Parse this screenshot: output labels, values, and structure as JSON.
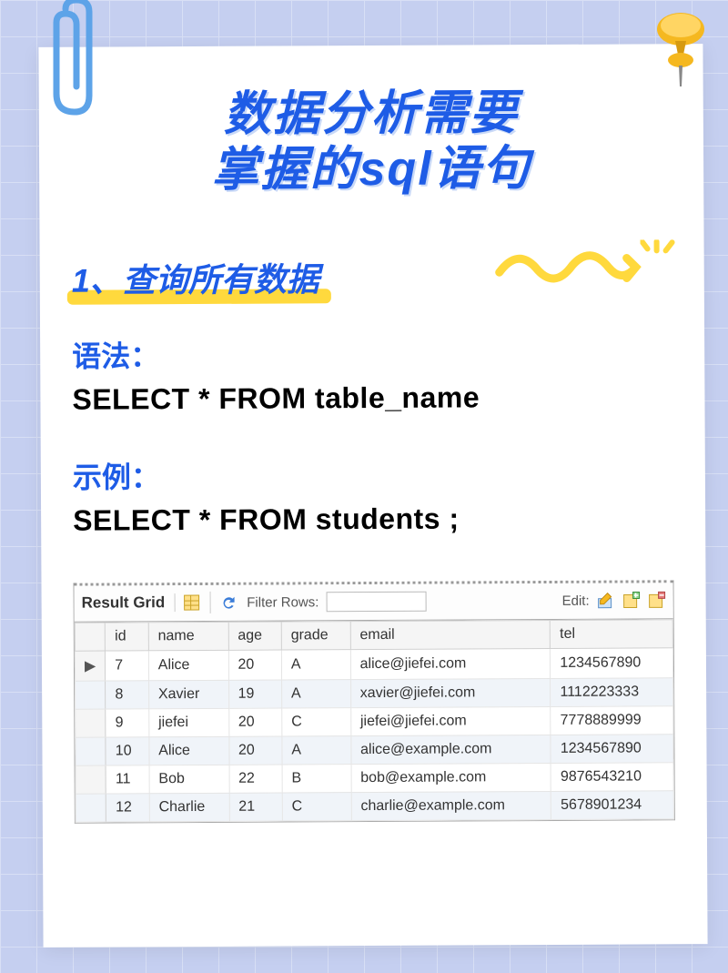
{
  "title_line1": "数据分析需要",
  "title_line2": "掌握的sql语句",
  "section_heading": "1、查询所有数据",
  "syntax_label": "语法：",
  "syntax_code": "SELECT * FROM table_name",
  "example_label": "示例：",
  "example_code": "SELECT * FROM students ;",
  "toolbar": {
    "result_grid": "Result Grid",
    "filter_label": "Filter Rows:",
    "edit_label": "Edit:"
  },
  "columns": [
    "id",
    "name",
    "age",
    "grade",
    "email",
    "tel"
  ],
  "rows": [
    {
      "ptr": "▶",
      "id": "7",
      "name": "Alice",
      "age": "20",
      "grade": "A",
      "email": "alice@jiefei.com",
      "tel": "1234567890"
    },
    {
      "ptr": "",
      "id": "8",
      "name": "Xavier",
      "age": "19",
      "grade": "A",
      "email": "xavier@jiefei.com",
      "tel": "1112223333"
    },
    {
      "ptr": "",
      "id": "9",
      "name": "jiefei",
      "age": "20",
      "grade": "C",
      "email": "jiefei@jiefei.com",
      "tel": "7778889999"
    },
    {
      "ptr": "",
      "id": "10",
      "name": "Alice",
      "age": "20",
      "grade": "A",
      "email": "alice@example.com",
      "tel": "1234567890"
    },
    {
      "ptr": "",
      "id": "11",
      "name": "Bob",
      "age": "22",
      "grade": "B",
      "email": "bob@example.com",
      "tel": "9876543210"
    },
    {
      "ptr": "",
      "id": "12",
      "name": "Charlie",
      "age": "21",
      "grade": "C",
      "email": "charlie@example.com",
      "tel": "5678901234"
    }
  ]
}
